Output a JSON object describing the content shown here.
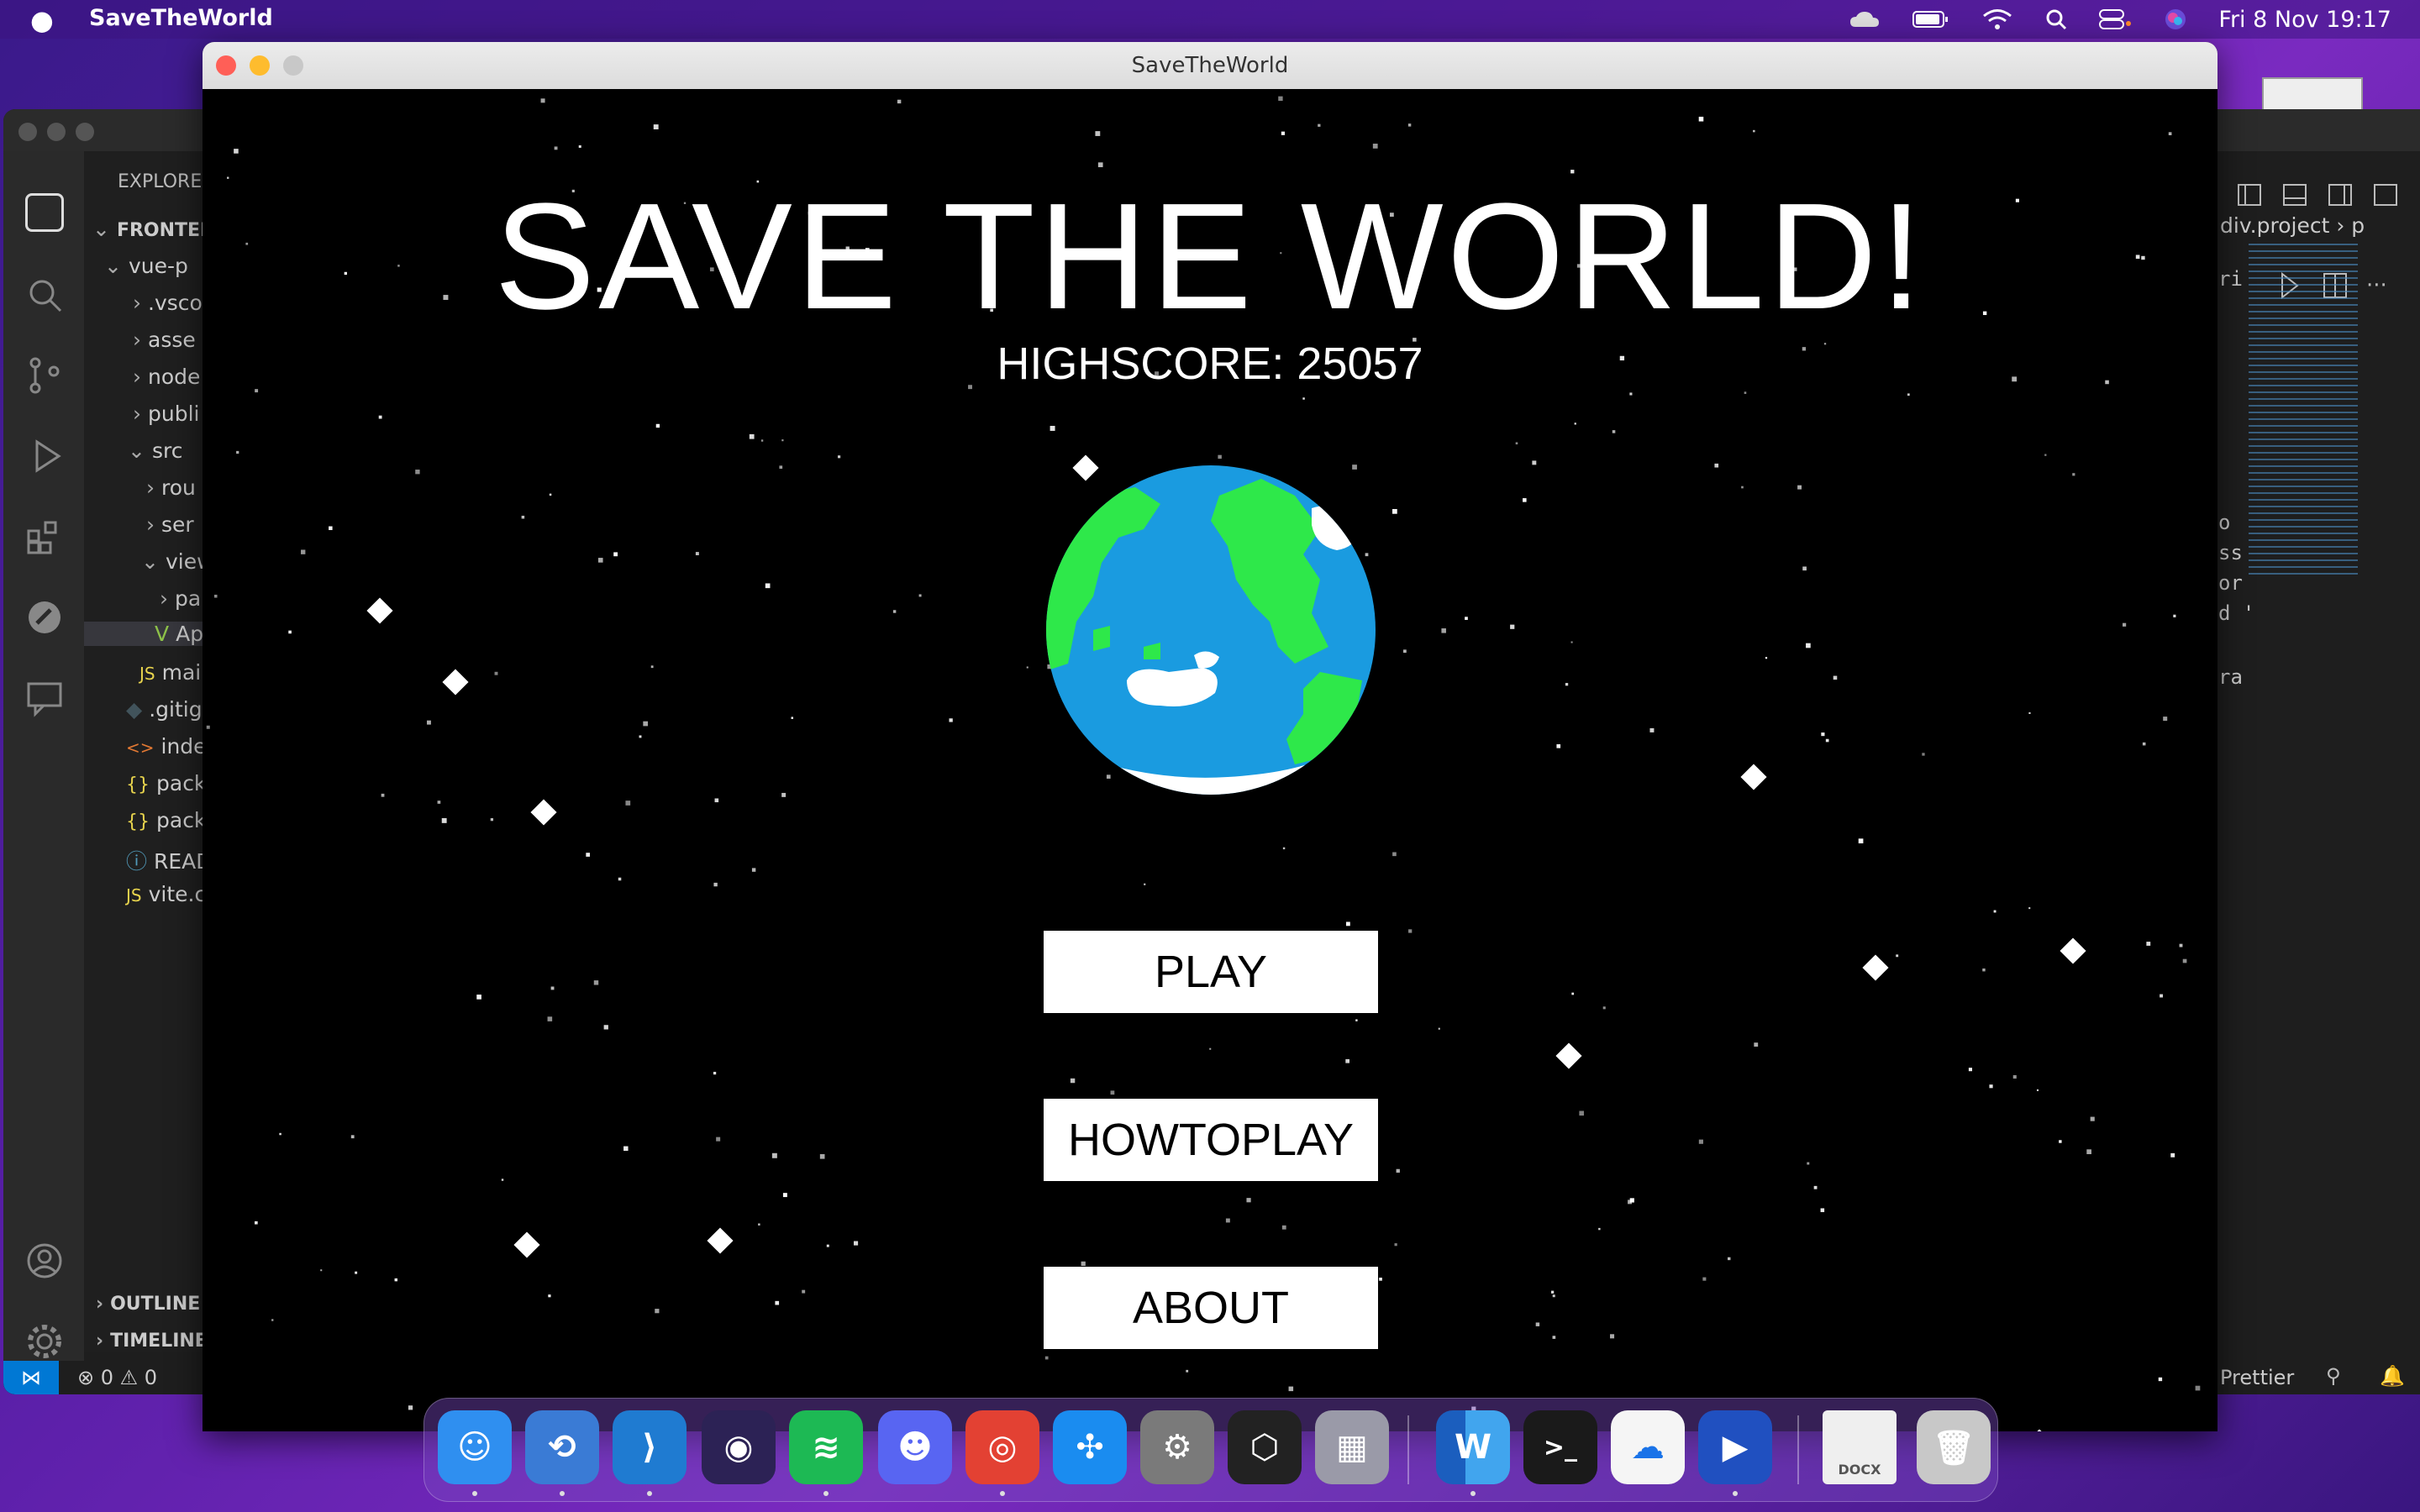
{
  "menubar": {
    "app_name": "SaveTheWorld",
    "clock": "Fri 8 Nov  19:17",
    "status_icons": [
      "cloud-icon",
      "battery-icon",
      "wifi-icon",
      "spotlight-search-icon",
      "control-center-icon",
      "siri-icon"
    ]
  },
  "window": {
    "title": "SaveTheWorld"
  },
  "game": {
    "title": "SAVE THE WORLD!",
    "highscore_label": "HIGHSCORE: 25057",
    "buttons": {
      "play": "PLAY",
      "howtoplay": "HOWTOPLAY",
      "about": "ABOUT"
    },
    "colors": {
      "background": "#000000",
      "ocean": "#1a9be0",
      "land": "#2ee84a",
      "clouds": "#ffffff",
      "stars": "#ffffff"
    }
  },
  "vscode_left": {
    "explorer_header": "EXPLORE",
    "tree": [
      {
        "label": "FRONTEN",
        "chev": "⌄"
      },
      {
        "label": "vue-p",
        "chev": "⌄"
      },
      {
        "label": ".vsco",
        "chev": "›"
      },
      {
        "label": "asse",
        "chev": "›"
      },
      {
        "label": "node",
        "chev": "›"
      },
      {
        "label": "publi",
        "chev": "›"
      },
      {
        "label": "src",
        "chev": "⌄"
      },
      {
        "label": "rou",
        "chev": "›"
      },
      {
        "label": "ser",
        "chev": "›"
      },
      {
        "label": "view",
        "chev": "⌄"
      },
      {
        "label": "pa",
        "chev": "›"
      },
      {
        "label": "Ap",
        "chev": "V"
      },
      {
        "label": "mai",
        "chev": "JS"
      },
      {
        "label": ".gitig",
        "chev": "◆"
      },
      {
        "label": "index",
        "chev": "<>"
      },
      {
        "label": "pack",
        "chev": "{}"
      },
      {
        "label": "pack",
        "chev": "{}"
      },
      {
        "label": "READ",
        "chev": "ⓘ"
      },
      {
        "label": "vite.c",
        "chev": "JS"
      }
    ],
    "outline": "OUTLINE",
    "timeline": "TIMELINE",
    "status": "⊗ 0 ⚠ 0"
  },
  "vscode_right": {
    "breadcrumb": "div.project ›  p",
    "code_fragments": [
      "ri",
      "o",
      "ss",
      "or",
      "d '",
      "ra"
    ],
    "status": "Prettier"
  },
  "dock": {
    "apps": [
      {
        "name": "finder-icon",
        "color": "#2f8ff0",
        "glyph": "☺"
      },
      {
        "name": "jetbrains-toolbox-icon",
        "color": "#3a7bd5",
        "glyph": "⟲"
      },
      {
        "name": "vscode-icon",
        "color": "#1f7bd1",
        "glyph": "⟩"
      },
      {
        "name": "eclipse-icon",
        "color": "#2c2255",
        "glyph": "◉"
      },
      {
        "name": "spotify-icon",
        "color": "#1db954",
        "glyph": "≋"
      },
      {
        "name": "discord-icon",
        "color": "#5865f2",
        "glyph": "☻"
      },
      {
        "name": "chrome-icon",
        "color": "#e34133",
        "glyph": "◎"
      },
      {
        "name": "safari-icon",
        "color": "#1a8cf0",
        "glyph": "✣"
      },
      {
        "name": "system-settings-icon",
        "color": "#7a7a7a",
        "glyph": "⚙"
      },
      {
        "name": "unity-hub-icon",
        "color": "#222222",
        "glyph": "⬡"
      },
      {
        "name": "launchpad-icon",
        "color": "#9a9aa8",
        "glyph": "▦"
      },
      {
        "name": "word-icon",
        "color": "#1b5ebe",
        "glyph": "W"
      },
      {
        "name": "terminal-icon",
        "color": "#1a1a1a",
        "glyph": ">_"
      },
      {
        "name": "onedrive-icon",
        "color": "#f5f5f5",
        "glyph": "☁"
      },
      {
        "name": "quicktime-icon",
        "color": "#2050c0",
        "glyph": "▶"
      },
      {
        "name": "docx-file-icon",
        "color": "#efefef",
        "glyph": "DOCX"
      },
      {
        "name": "trash-icon",
        "color": "#c8c8c8",
        "glyph": "🗑"
      }
    ]
  }
}
